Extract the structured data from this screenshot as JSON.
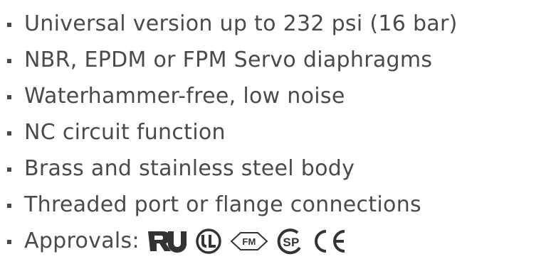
{
  "features": [
    "Universal version up to 232 psi (16 bar)",
    "NBR, EPDM or FPM Servo diaphragms",
    "Waterhammer-free, low noise",
    "NC circuit function",
    "Brass and stainless steel body",
    "Threaded port or flange connections"
  ],
  "approvals": {
    "label": "Approvals:",
    "marks": [
      {
        "icon": "ur-recognized-mark-icon",
        "text": "RU"
      },
      {
        "icon": "ul-listed-mark-icon",
        "text": "UL"
      },
      {
        "icon": "fm-approved-mark-icon",
        "text": "FM"
      },
      {
        "icon": "csa-mark-icon",
        "text": "SP"
      },
      {
        "icon": "ce-mark-icon",
        "text": "CE"
      }
    ]
  },
  "colors": {
    "text": "#4a4a4a",
    "mark": "#333333"
  }
}
